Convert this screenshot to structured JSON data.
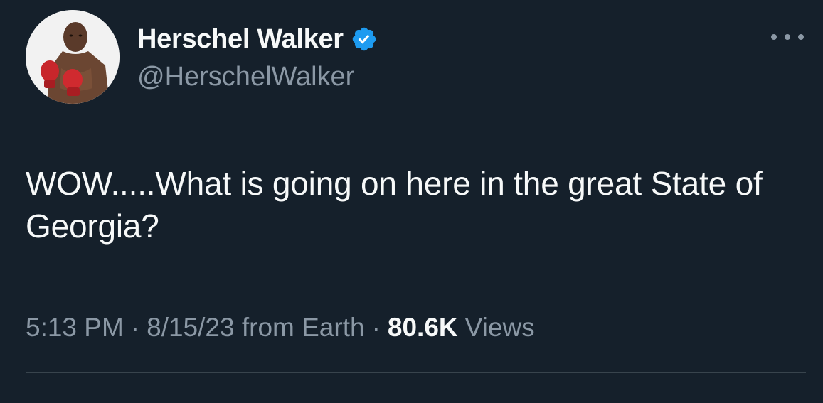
{
  "author": {
    "display_name": "Herschel Walker",
    "handle": "@HerschelWalker",
    "verified": true,
    "verified_color": "#1d9bf0"
  },
  "tweet": {
    "text": "WOW.....What is going on here in the great State of Georgia?"
  },
  "meta": {
    "time": "5:13 PM",
    "separator": "·",
    "date_source": "8/15/23 from Earth",
    "views_count": "80.6K",
    "views_label": "Views"
  },
  "icons": {
    "more": "more-horizontal-icon",
    "verified": "verified-badge-icon"
  },
  "colors": {
    "background": "#15202b",
    "primary_text": "#f7f9f9",
    "secondary_text": "#8b98a5",
    "divider": "#38444d"
  }
}
